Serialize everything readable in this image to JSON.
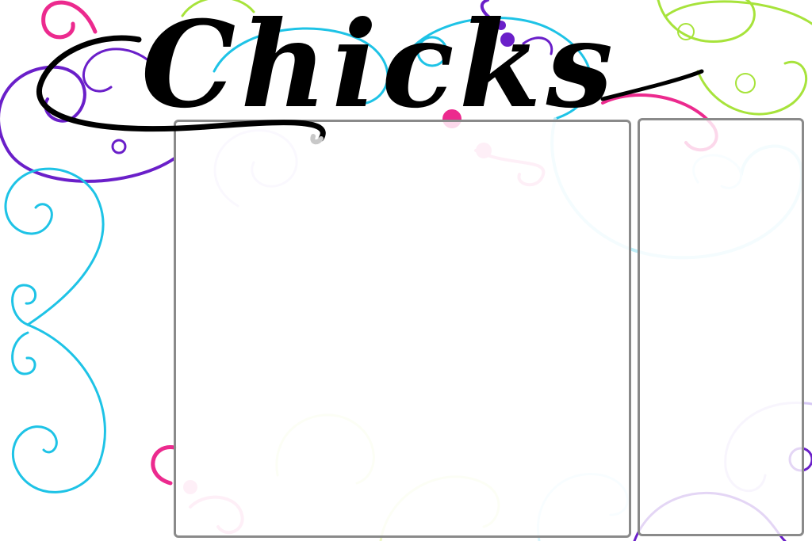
{
  "title": {
    "text": "Chicks"
  },
  "palette": {
    "pink": "#ec2a8e",
    "purple": "#6a1fc9",
    "cyan": "#1ec3e6",
    "lime": "#a7e33b",
    "panel_border": "#8a8a8a",
    "title": "#000000"
  },
  "panels": {
    "main": {},
    "side": {}
  }
}
